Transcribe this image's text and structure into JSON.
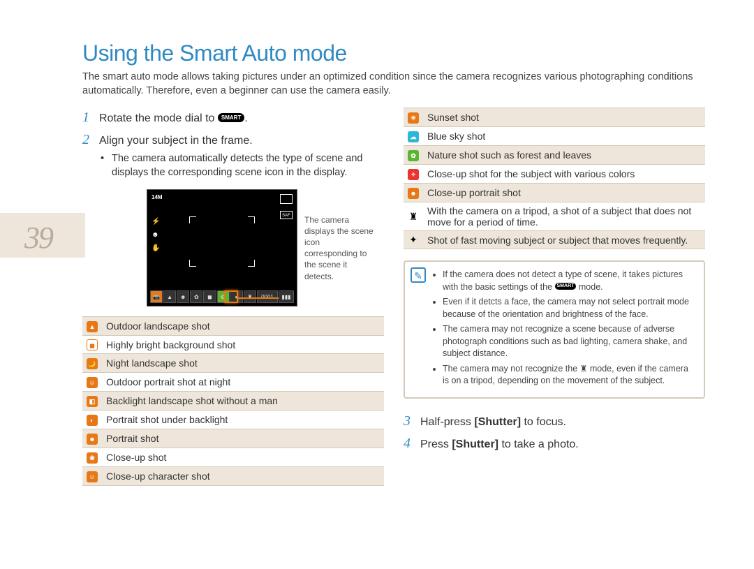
{
  "page_number": "39",
  "title": "Using the Smart Auto mode",
  "intro": "The smart auto mode allows taking pictures under an optimized condition since the camera recognizes various photographing conditions automatically. Therefore, even a beginner can use the camera easily.",
  "steps": {
    "s1_pre": "Rotate the mode dial to ",
    "s1_badge": "SMART",
    "s1_post": ".",
    "s2": "Align your subject in the frame.",
    "s2_sub": "The camera automatically detects the type of scene and displays the corresponding scene icon in the display.",
    "s3_pre": "Half-press ",
    "s3_bold": "[Shutter]",
    "s3_post": " to focus.",
    "s4_pre": "Press ",
    "s4_bold": "[Shutter]",
    "s4_post": " to take a photo."
  },
  "callout": "The camera displays the scene icon corresponding to the scene it detects.",
  "lcd": {
    "res": "14M",
    "saf": "SAF",
    "counter": "0001"
  },
  "icons_left": [
    {
      "bg": "#e67817",
      "glyph": "▲",
      "label": "Outdoor landscape shot"
    },
    {
      "bg": "#fff",
      "glyph": "◼",
      "label": "Highly bright background shot",
      "fg": "#e67817",
      "border": "1px solid #e67817"
    },
    {
      "bg": "#e67817",
      "glyph": "🌙",
      "label": "Night landscape shot"
    },
    {
      "bg": "#e67817",
      "glyph": "☺",
      "label": "Outdoor portrait shot at night"
    },
    {
      "bg": "#e67817",
      "glyph": "◧",
      "label": "Backlight landscape shot without a man"
    },
    {
      "bg": "#e67817",
      "glyph": "◐",
      "label": "Portrait shot under backlight"
    },
    {
      "bg": "#e67817",
      "glyph": "☻",
      "label": "Portrait shot"
    },
    {
      "bg": "#e67817",
      "glyph": "❀",
      "label": "Close-up shot"
    },
    {
      "bg": "#e67817",
      "glyph": "☺",
      "label": "Close-up character shot"
    }
  ],
  "icons_right": [
    {
      "bg": "#e67817",
      "glyph": "☀",
      "label": "Sunset shot"
    },
    {
      "bg": "#2bb8d6",
      "glyph": "☁",
      "label": "Blue sky shot"
    },
    {
      "bg": "#5cb430",
      "glyph": "✿",
      "label": "Nature shot such as forest and leaves"
    },
    {
      "bg": "#e33",
      "glyph": "✧",
      "label": "Close-up shot for the subject with various colors"
    },
    {
      "bg": "#e67817",
      "glyph": "☻",
      "label": "Close-up portrait shot"
    },
    {
      "stick": "♜",
      "label": "With the camera on a tripod, a shot of a subject that does not move for a period of time."
    },
    {
      "stick": "✦",
      "label": "Shot of fast moving subject or subject that moves frequently."
    }
  ],
  "notes": {
    "n1_pre": "If the camera does not detect a type of scene, it takes pictures with the basic settings of the ",
    "n1_icon": "SMART",
    "n1_post": " mode.",
    "n2": "Even if it detcts a face, the camera may not select portrait mode because of the orientation and brightness of the face.",
    "n3": "The camera may not recognize a scene because of adverse photograph conditions such as bad lighting, camera shake, and subject distance.",
    "n4_pre": "The camera may not recognize the ",
    "n4_post": " mode, even if the camera is on a tripod, depending on the movement of the subject."
  }
}
